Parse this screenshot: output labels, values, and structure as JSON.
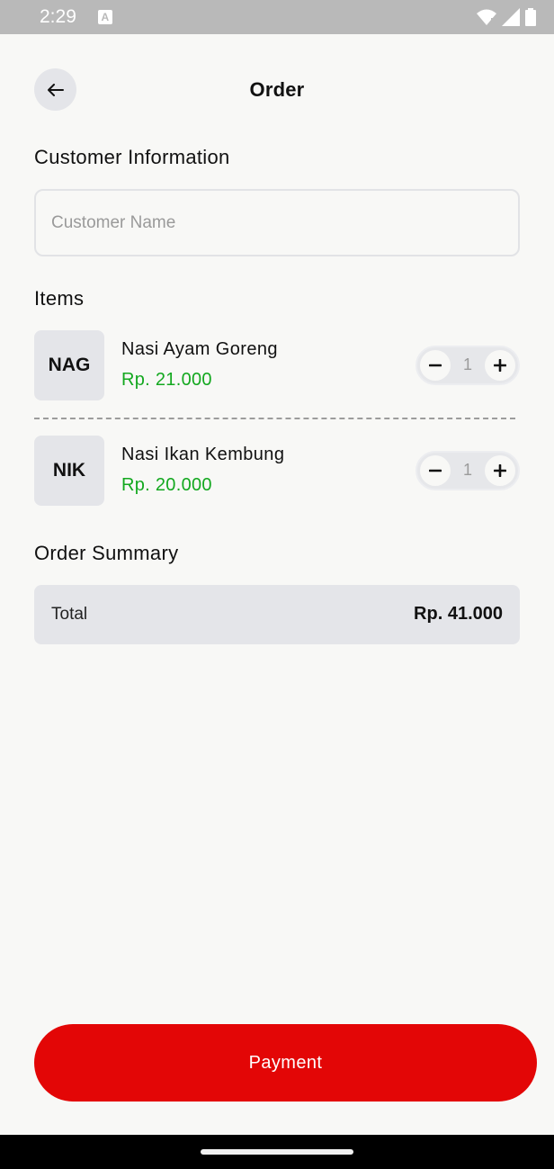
{
  "status_bar": {
    "time": "2:29",
    "notification_icon_letter": "A"
  },
  "header": {
    "title": "Order",
    "back_icon": "arrow-left-icon"
  },
  "customer": {
    "section_title": "Customer Information",
    "name_placeholder": "Customer Name",
    "name_value": ""
  },
  "items": {
    "section_title": "Items",
    "list": [
      {
        "initials": "NAG",
        "name": "Nasi Ayam Goreng",
        "price": "Rp. 21.000",
        "qty": "1"
      },
      {
        "initials": "NIK",
        "name": "Nasi Ikan Kembung",
        "price": "Rp. 20.000",
        "qty": "1"
      }
    ]
  },
  "summary": {
    "section_title": "Order Summary",
    "total_label": "Total",
    "total_value": "Rp. 41.000"
  },
  "payment": {
    "label": "Payment"
  },
  "colors": {
    "accent": "#e30606",
    "price": "#13a81f",
    "surface": "#e4e5e9",
    "background": "#f8f8f6"
  }
}
